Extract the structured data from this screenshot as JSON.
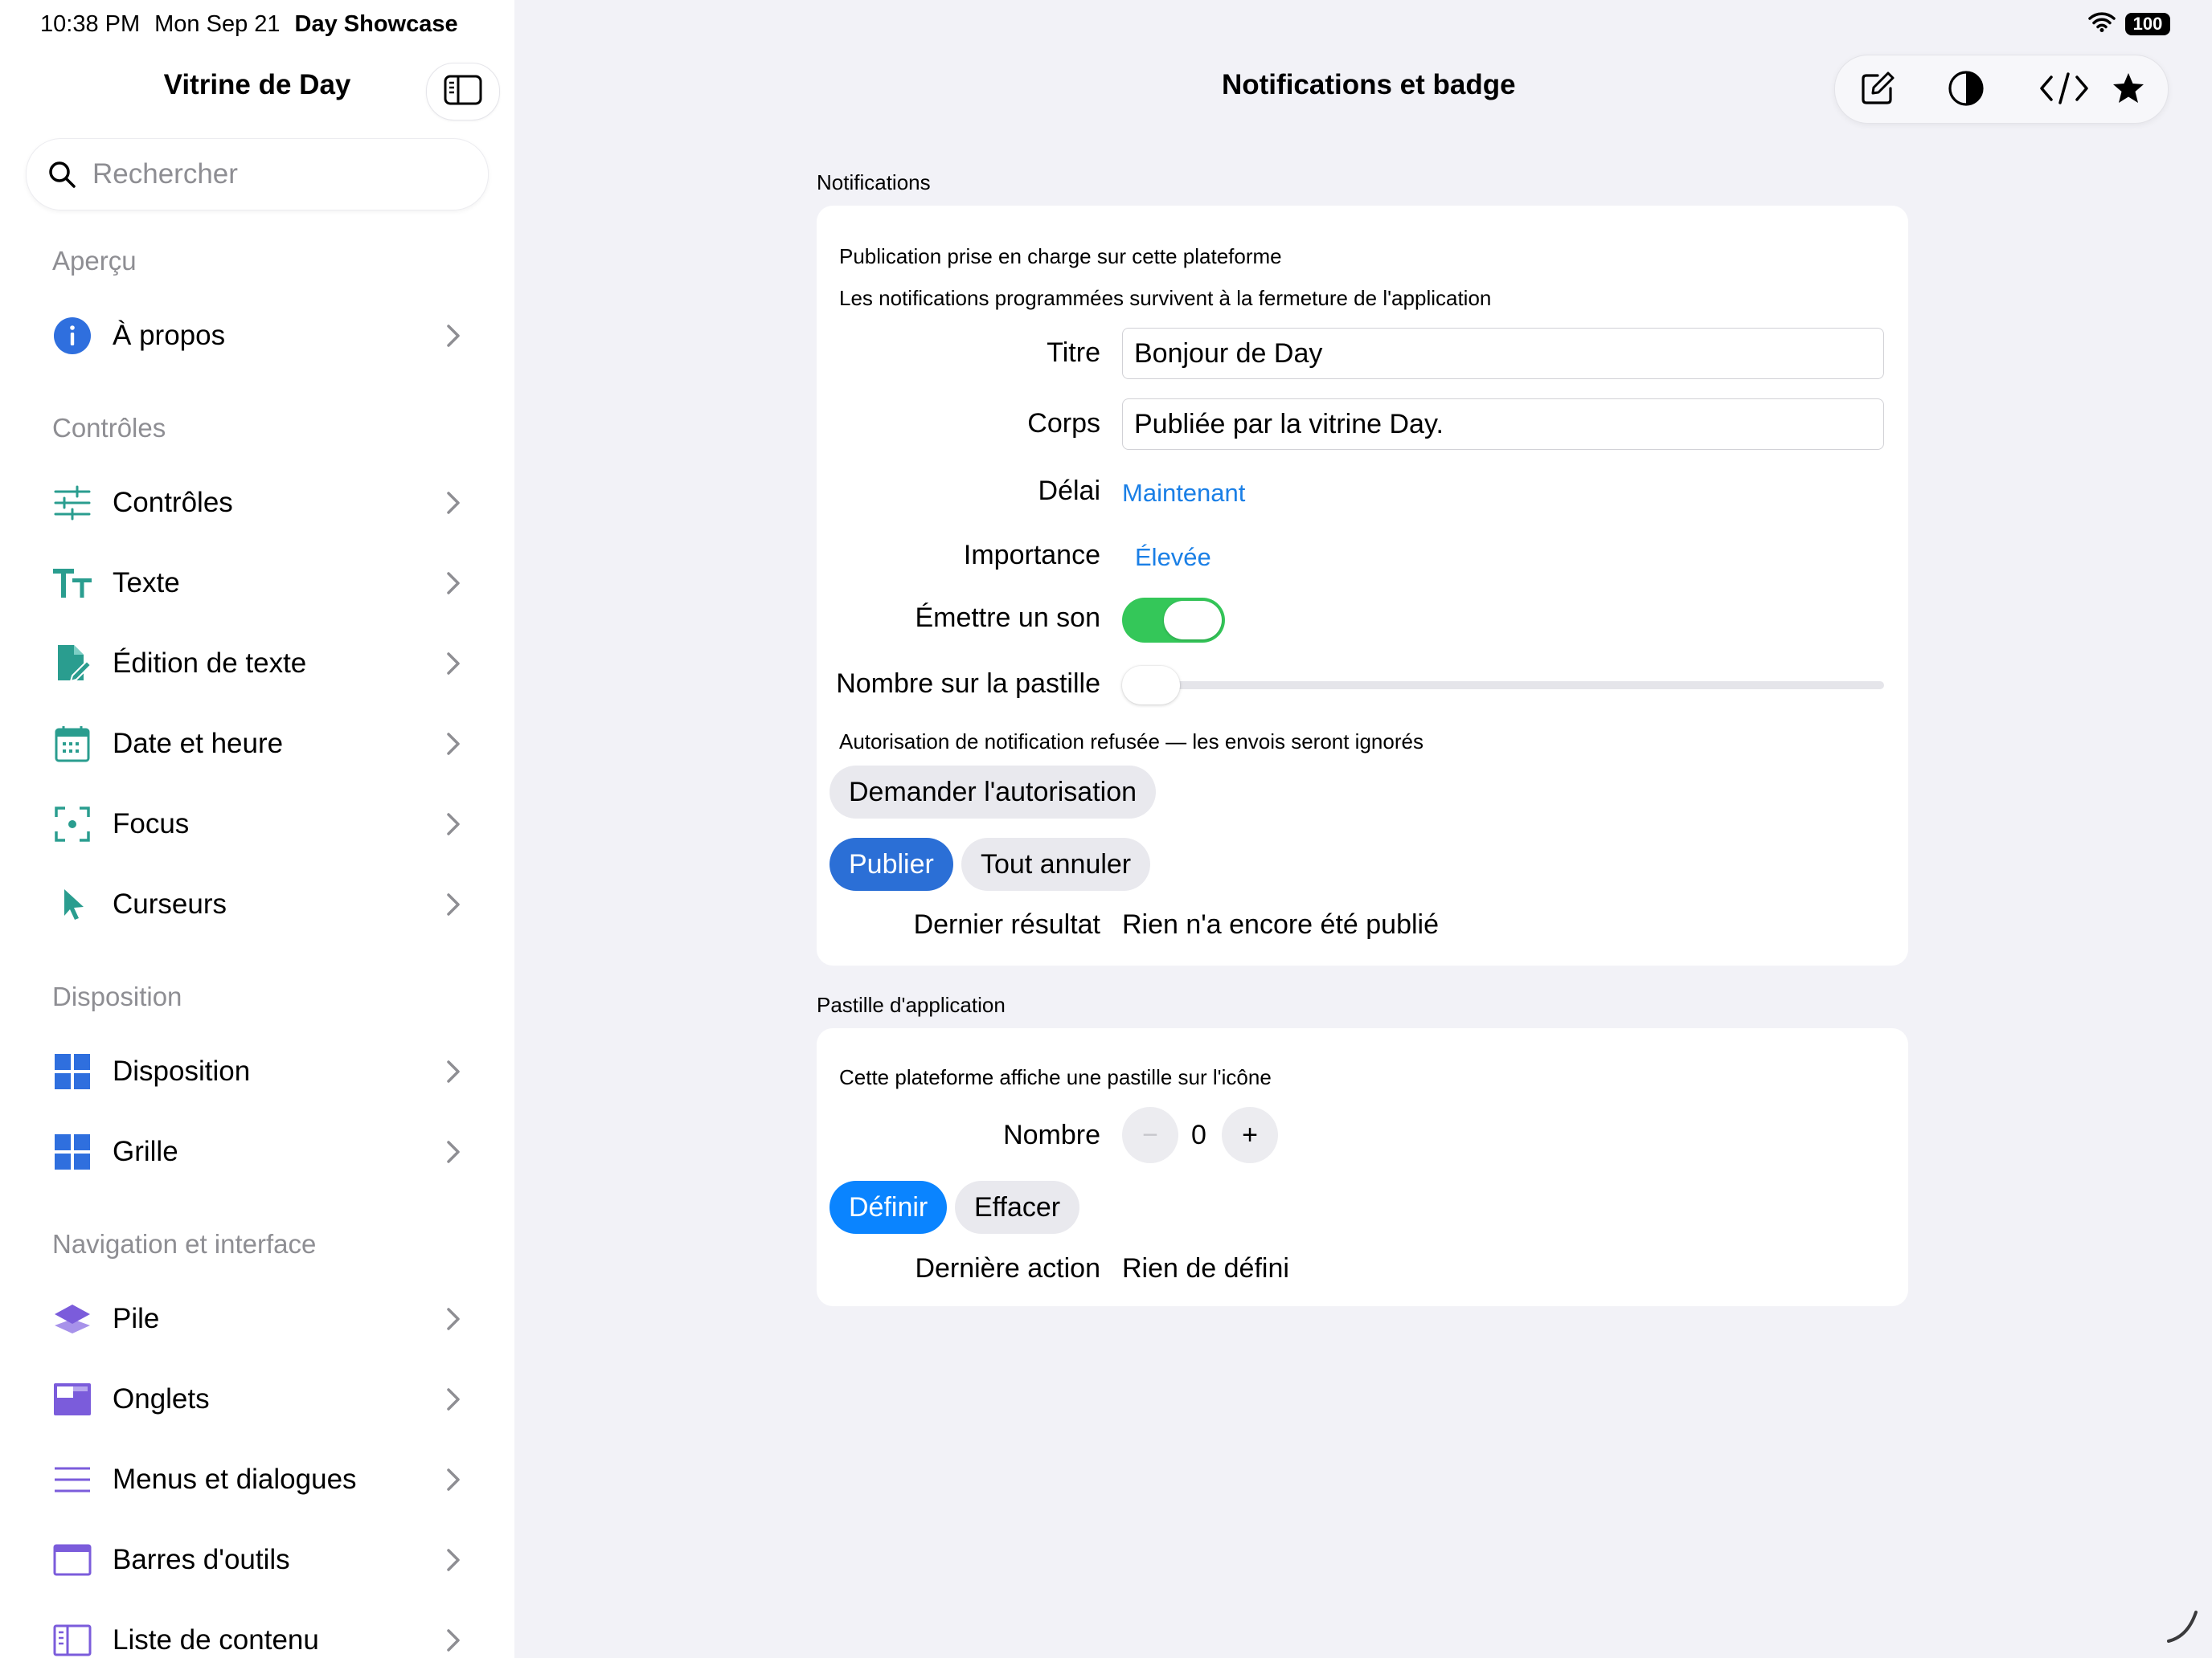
{
  "status_bar": {
    "time": "10:38 PM",
    "date": "Mon Sep 21",
    "app": "Day Showcase",
    "battery": "100"
  },
  "sidebar": {
    "title": "Vitrine de Day",
    "search_placeholder": "Rechercher",
    "sections": {
      "apercu": "Aperçu",
      "controles": "Contrôles",
      "disposition": "Disposition",
      "navigation": "Navigation et interface"
    },
    "items": {
      "a_propos": "À propos",
      "controles": "Contrôles",
      "texte": "Texte",
      "edition": "Édition de texte",
      "date": "Date et heure",
      "focus": "Focus",
      "curseurs": "Curseurs",
      "disposition": "Disposition",
      "grille": "Grille",
      "pile": "Pile",
      "onglets": "Onglets",
      "menus": "Menus et dialogues",
      "barres": "Barres d'outils",
      "liste": "Liste de contenu"
    },
    "icons": {
      "a_propos": "info-icon",
      "controles": "sliders-icon",
      "texte": "text-size-icon",
      "edition": "document-edit-icon",
      "date": "calendar-icon",
      "focus": "focus-icon",
      "curseurs": "pointer-icon",
      "disposition": "layout-icon",
      "grille": "grid-icon",
      "pile": "stack-icon",
      "onglets": "tabs-icon",
      "menus": "menu-lines-icon",
      "barres": "toolbar-window-icon",
      "liste": "sidebar-list-icon"
    },
    "colors": {
      "info": "#2f6fde",
      "teal": "#2a9d8f",
      "blue": "#2f6fde",
      "purple": "#7b5cdb"
    }
  },
  "main": {
    "title": "Notifications et badge",
    "toolbar_icons": [
      "compose-icon",
      "contrast-icon",
      "code-icon",
      "star-icon"
    ],
    "notifications": {
      "header": "Notifications",
      "info_1": "Publication prise en charge sur cette plateforme",
      "info_2": "Les notifications programmées survivent à la fermeture de l'application",
      "title_label": "Titre",
      "title_value": "Bonjour de Day",
      "body_label": "Corps",
      "body_value": "Publiée par la vitrine Day.",
      "delay_label": "Délai",
      "delay_value": "Maintenant",
      "importance_label": "Importance",
      "importance_value": "Élevée",
      "sound_label": "Émettre un son",
      "sound_on": true,
      "badge_number_label": "Nombre sur la pastille",
      "badge_number_slider": 0,
      "permission_info": "Autorisation de notification refusée — les envois seront ignorés",
      "request_button": "Demander l'autorisation",
      "publish_button": "Publier",
      "cancel_all_button": "Tout annuler",
      "last_result_label": "Dernier résultat",
      "last_result_value": "Rien n'a encore été publié"
    },
    "badge": {
      "header": "Pastille d'application",
      "info": "Cette plateforme affiche une pastille sur l'icône",
      "count_label": "Nombre",
      "count_value": "0",
      "minus": "−",
      "plus": "+",
      "set_button": "Définir",
      "clear_button": "Effacer",
      "last_action_label": "Dernière action",
      "last_action_value": "Rien de défini"
    },
    "accent_colors": {
      "link": "#1a7fe6",
      "toggle_on": "#34c759",
      "publish": "#2b6fd6",
      "set": "#0a84ff"
    }
  }
}
